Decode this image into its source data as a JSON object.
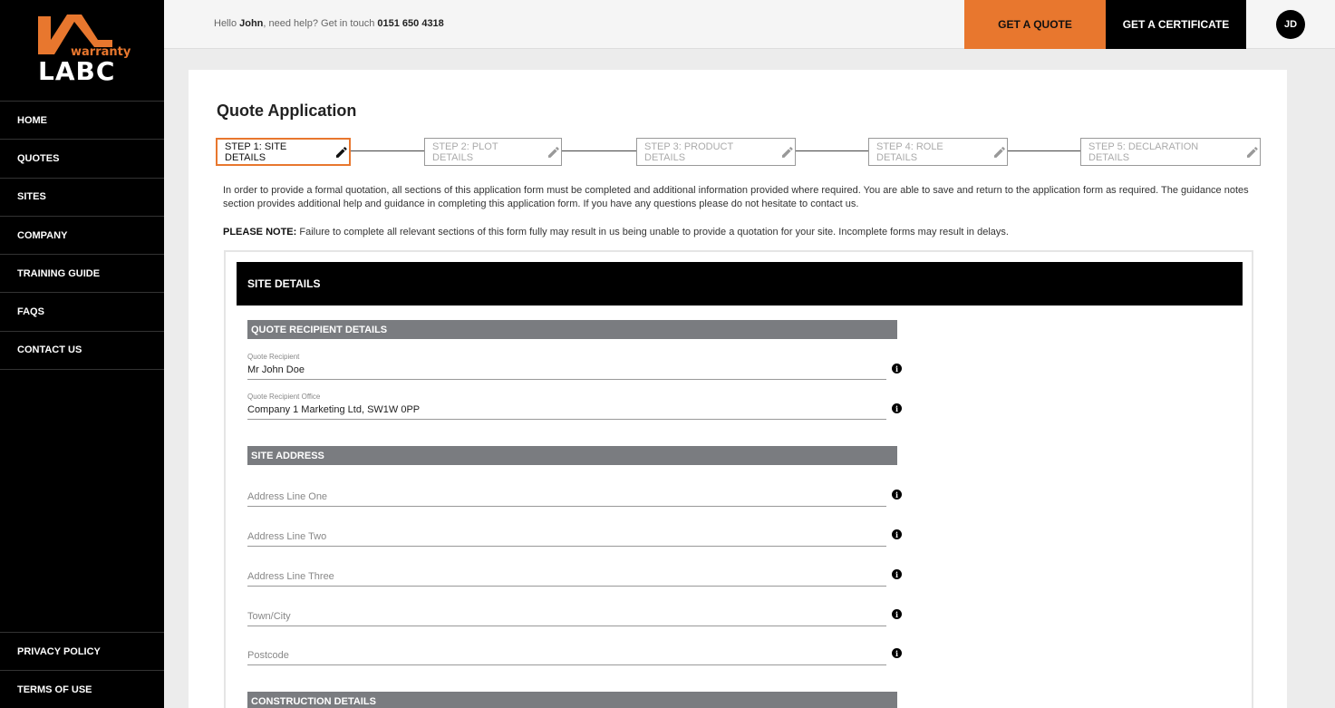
{
  "brand": {
    "small": "warranty",
    "big": "LABC",
    "accent": "#e8772e"
  },
  "nav": {
    "items": [
      {
        "label": "HOME"
      },
      {
        "label": "QUOTES"
      },
      {
        "label": "SITES"
      },
      {
        "label": "COMPANY"
      },
      {
        "label": "TRAINING GUIDE"
      },
      {
        "label": "FAQS"
      },
      {
        "label": "CONTACT US"
      }
    ],
    "bottom": [
      {
        "label": "PRIVACY POLICY"
      },
      {
        "label": "TERMS OF USE"
      }
    ]
  },
  "topbar": {
    "hello_prefix": "Hello ",
    "user": "John",
    "hello_suffix": ", need help? Get in touch ",
    "phone": "0151 650 4318",
    "quote_label": "GET A QUOTE",
    "cert_label": "GET A CERTIFICATE",
    "avatar_initials": "JD"
  },
  "page": {
    "title": "Quote Application",
    "steps": [
      {
        "label": "STEP 1: SITE DETAILS"
      },
      {
        "label": "STEP 2: PLOT DETAILS"
      },
      {
        "label": "STEP 3: PRODUCT DETAILS"
      },
      {
        "label": "STEP 4: ROLE DETAILS"
      },
      {
        "label": "STEP 5: DECLARATION DETAILS"
      }
    ],
    "intro": "In order to provide a formal quotation, all sections of this application form must be completed and additional information provided where required. You are able to save and return to the application form as required. The guidance notes section provides additional help and guidance in completing this application form. If you have any questions please do not hesitate to contact us.",
    "note_label": "PLEASE NOTE:",
    "note_text": " Failure to complete all relevant sections of this form fully may result in us being unable to provide a quotation for your site. Incomplete forms may result in delays."
  },
  "form": {
    "section_title": "SITE DETAILS",
    "recipient_head": "QUOTE RECIPIENT DETAILS",
    "recipient": {
      "label": "Quote Recipient",
      "value": "Mr John Doe"
    },
    "office": {
      "label": "Quote Recipient Office",
      "value": "Company 1 Marketing Ltd, SW1W 0PP"
    },
    "address_head": "SITE ADDRESS",
    "address_fields": [
      {
        "placeholder": "Address Line One"
      },
      {
        "placeholder": "Address Line Two"
      },
      {
        "placeholder": "Address Line Three"
      },
      {
        "placeholder": "Town/City"
      },
      {
        "placeholder": "Postcode"
      }
    ],
    "construction_head": "CONSTRUCTION DETAILS",
    "info_glyph": "i"
  }
}
